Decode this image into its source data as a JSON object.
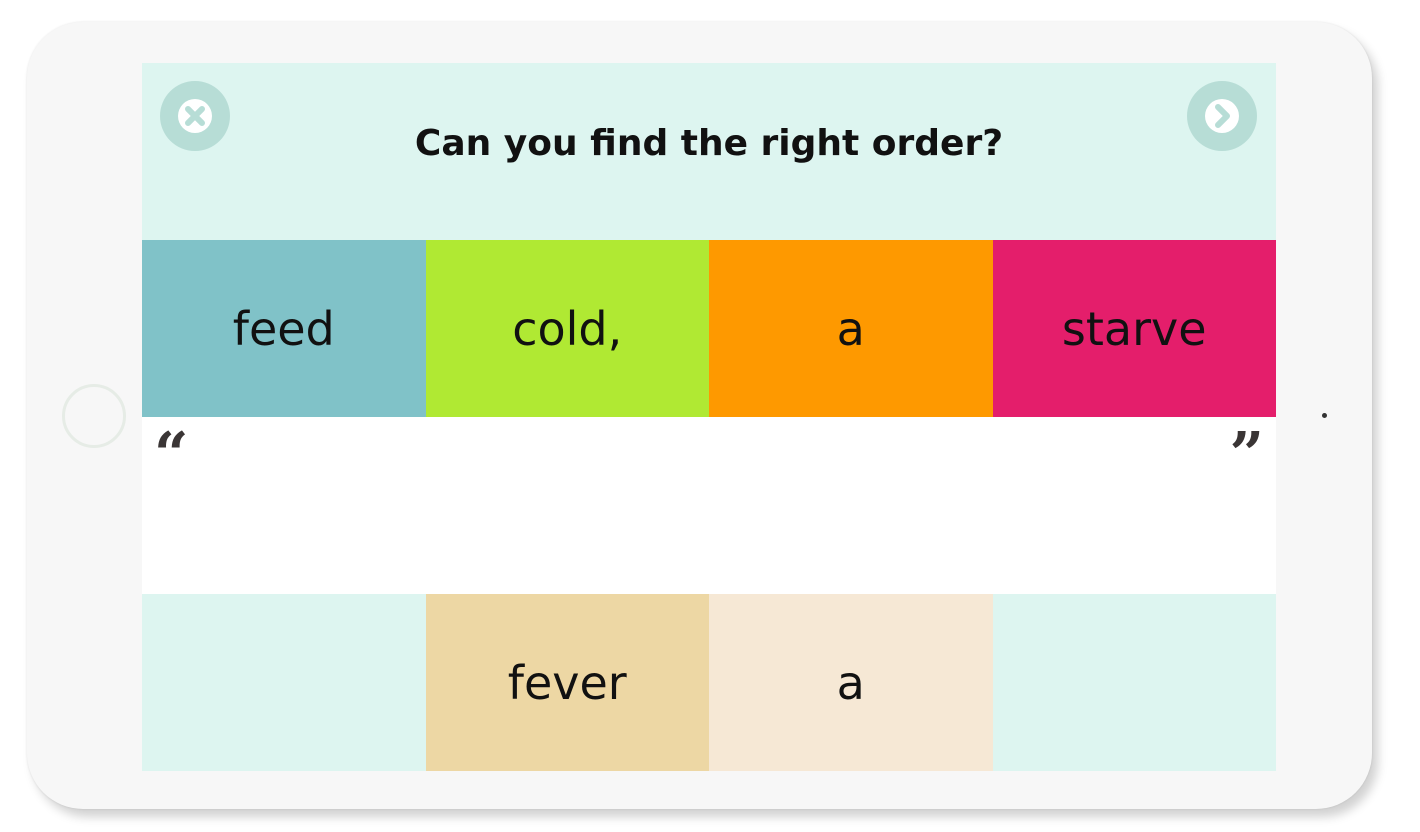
{
  "prompt": "Can you find the right order?",
  "controls": {
    "close_icon": "close-icon",
    "next_icon": "chevron-right-icon"
  },
  "word_choices": [
    {
      "text": "feed",
      "color": "#80c2c8"
    },
    {
      "text": "cold,",
      "color": "#b0e933"
    },
    {
      "text": "a",
      "color": "#fe9900"
    },
    {
      "text": "starve",
      "color": "#e41e6b"
    }
  ],
  "answer_area": {
    "open_quote": "“",
    "close_quote": "”"
  },
  "remaining_words": [
    {
      "text": "",
      "color": "#ddf5f0"
    },
    {
      "text": "fever",
      "color": "#edd7a4"
    },
    {
      "text": "a",
      "color": "#f6e8d5"
    },
    {
      "text": "",
      "color": "#ddf5f0"
    }
  ]
}
